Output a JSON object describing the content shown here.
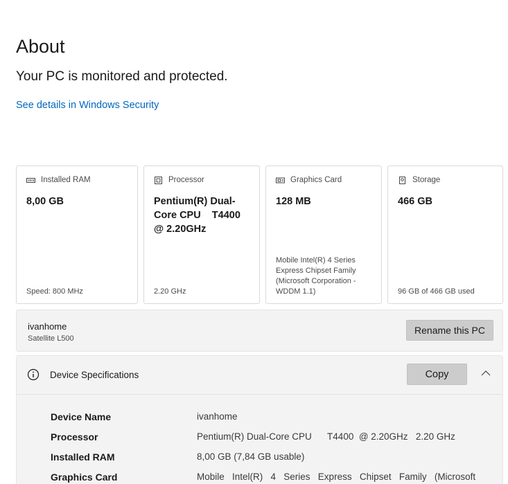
{
  "header": {
    "title": "About",
    "protection_status": "Your PC is monitored and protected.",
    "security_link": "See details in Windows Security"
  },
  "cards": [
    {
      "label": "Installed RAM",
      "icon": "memory-icon",
      "value": "8,00 GB",
      "extra": "",
      "footer": "Speed: 800 MHz"
    },
    {
      "label": "Processor",
      "icon": "processor-icon",
      "value": "Pentium(R) Dual-Core CPU    T4400 @ 2.20GHz",
      "extra": "",
      "footer": "2.20 GHz"
    },
    {
      "label": "Graphics Card",
      "icon": "graphics-card-icon",
      "value": "128 MB",
      "extra": "Mobile Intel(R) 4 Series Express Chipset Family (Microsoft Corporation - WDDM 1.1)",
      "footer": ""
    },
    {
      "label": "Storage",
      "icon": "storage-icon",
      "value": "466 GB",
      "extra": "",
      "footer": "96 GB of 466 GB used"
    }
  ],
  "pc": {
    "name": "ivanhome",
    "model": "Satellite L500",
    "rename_label": "Rename this PC"
  },
  "specs": {
    "title": "Device Specifications",
    "copy_label": "Copy",
    "rows": [
      {
        "label": "Device Name",
        "value": "ivanhome"
      },
      {
        "label": "Processor",
        "value": "Pentium(R) Dual-Core CPU      T4400  @ 2.20GHz   2.20 GHz"
      },
      {
        "label": "Installed RAM",
        "value": "8,00 GB (7,84 GB usable)"
      },
      {
        "label": "Graphics Card",
        "value": "Mobile   Intel(R)   4   Series   Express   Chipset   Family   (Microsoft"
      }
    ]
  },
  "colors": {
    "link": "#0067c0",
    "button_bg": "#cccccc",
    "panel_bg": "#f3f3f3"
  }
}
